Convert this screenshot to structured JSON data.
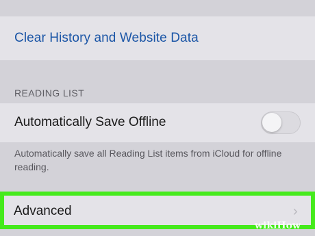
{
  "privacy": {
    "clear_history_label": "Clear History and Website Data"
  },
  "reading_list": {
    "section_header": "READING LIST",
    "auto_save_label": "Automatically Save Offline",
    "auto_save_enabled": false,
    "footer": "Automatically save all Reading List items from iCloud for offline reading."
  },
  "advanced": {
    "label": "Advanced",
    "chevron": "›",
    "chevron_icon": "chevron-right-icon"
  },
  "watermark": {
    "wiki": "wiki",
    "how": "How"
  },
  "colors": {
    "link": "#1a55a6",
    "highlight": "#45ea1c",
    "background": "#d3d2d8",
    "row": "#e4e3e8"
  }
}
